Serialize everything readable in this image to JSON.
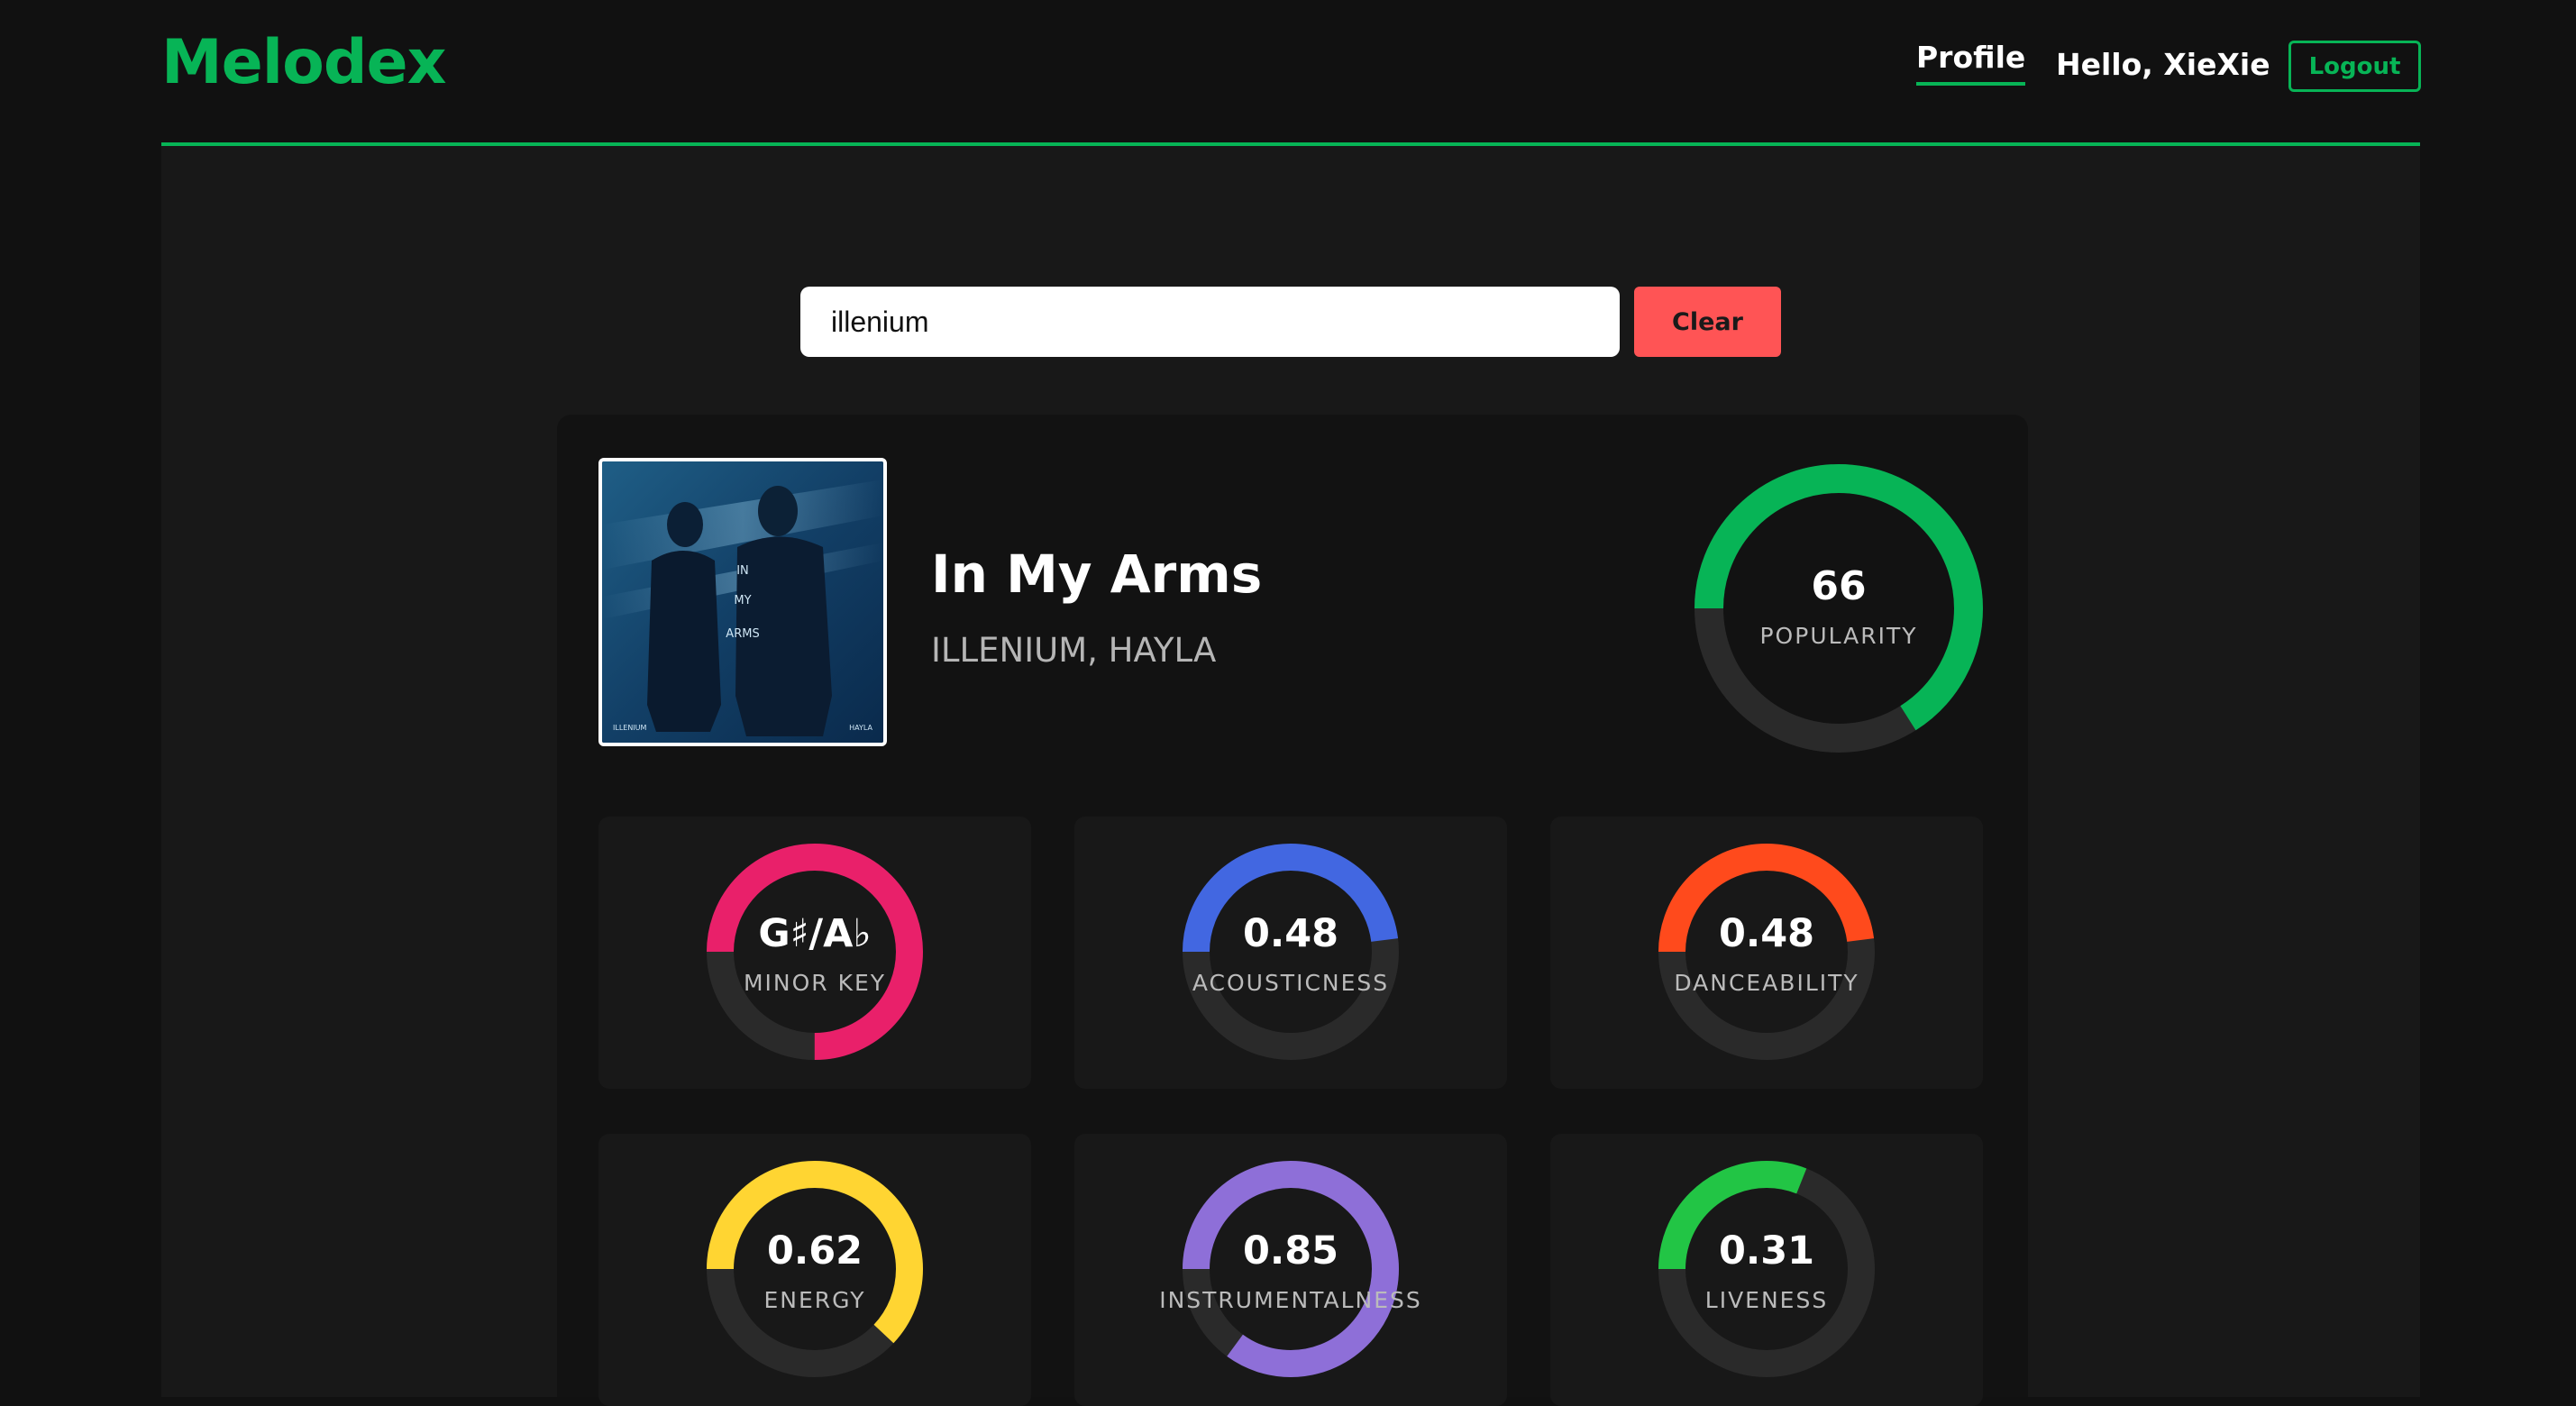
{
  "header": {
    "logo": "Melodex",
    "nav_profile": "Profile",
    "greeting": "Hello, XieXie",
    "logout_label": "Logout",
    "accent_color": "#07b456"
  },
  "search": {
    "value": "illenium",
    "clear_label": "Clear",
    "clear_color": "#ff5455"
  },
  "track": {
    "title": "In My Arms",
    "artists": "ILLENIUM, HAYLA",
    "album_art_text": {
      "line1": "IN",
      "line2": "MY",
      "line3": "ARMS",
      "left_credit": "ILLENIUM",
      "right_credit": "HAYLA"
    },
    "popularity": {
      "value": "66",
      "label": "POPULARITY",
      "fraction": 0.66,
      "color": "#07b456"
    }
  },
  "features": [
    {
      "value": "G♯/A♭",
      "label": "MINOR KEY",
      "fraction": 0.75,
      "color": "#e9206a"
    },
    {
      "value": "0.48",
      "label": "ACOUSTICNESS",
      "fraction": 0.48,
      "color": "#4267e1"
    },
    {
      "value": "0.48",
      "label": "DANCEABILITY",
      "fraction": 0.48,
      "color": "#ff4a1c"
    },
    {
      "value": "0.62",
      "label": "ENERGY",
      "fraction": 0.62,
      "color": "#ffd532"
    },
    {
      "value": "0.85",
      "label": "INSTRUMENTALNESS",
      "fraction": 0.85,
      "color": "#8e6fd8"
    },
    {
      "value": "0.31",
      "label": "LIVENESS",
      "fraction": 0.31,
      "color": "#22c545"
    }
  ]
}
